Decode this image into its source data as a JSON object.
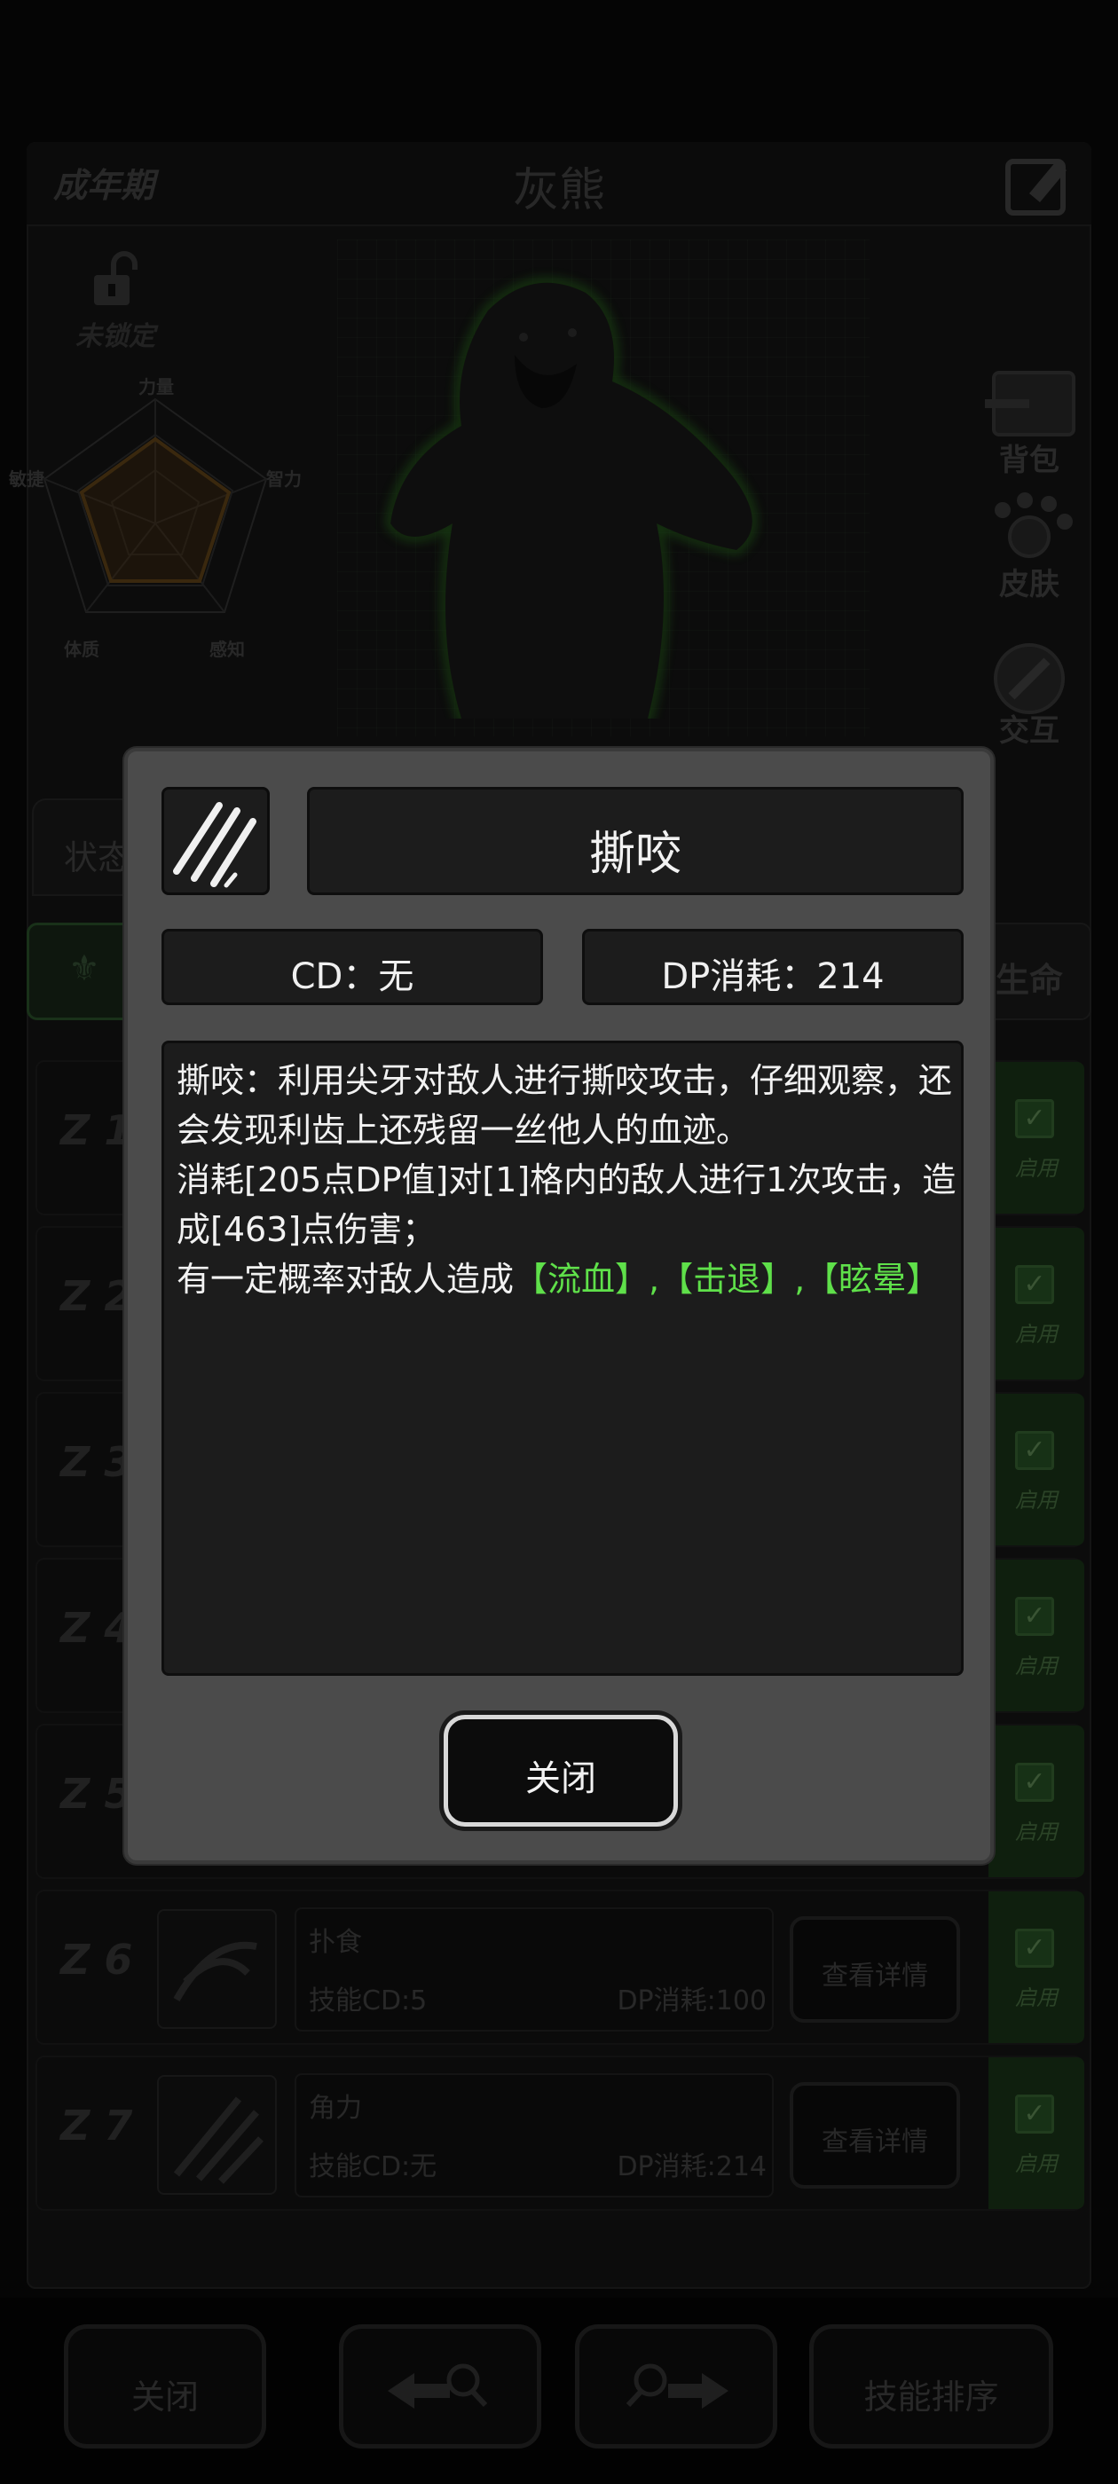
{
  "header": {
    "stage": "成年期",
    "name": "灰熊"
  },
  "lock": {
    "label": "未锁定"
  },
  "radar": {
    "labels": [
      "力量",
      "智力",
      "感知",
      "体质",
      "敏捷"
    ]
  },
  "side_buttons": [
    {
      "label": "背包",
      "icon": "backpack-icon"
    },
    {
      "label": "皮肤",
      "icon": "paw-icon"
    },
    {
      "label": "交互",
      "icon": "hand-icon"
    }
  ],
  "tabs": {
    "status": "状态"
  },
  "filters": {
    "right": "生命"
  },
  "skill_rows": [
    {
      "num": "1",
      "name": "",
      "cd": "",
      "dp": "",
      "detail": "",
      "enable": "启用"
    },
    {
      "num": "2",
      "name": "",
      "cd": "",
      "dp": "",
      "detail": "",
      "enable": "启用"
    },
    {
      "num": "3",
      "name": "",
      "cd": "",
      "dp": "",
      "detail": "",
      "enable": "启用"
    },
    {
      "num": "4",
      "name": "",
      "cd": "",
      "dp": "",
      "detail": "",
      "enable": "启用"
    },
    {
      "num": "5",
      "name": "",
      "cd": "",
      "dp": "",
      "detail": "",
      "enable": "启用"
    },
    {
      "num": "6",
      "name": "扑食",
      "cd": "技能CD:5",
      "dp": "DP消耗:100",
      "detail": "查看详情",
      "enable": "启用"
    },
    {
      "num": "7",
      "name": "角力",
      "cd": "技能CD:无",
      "dp": "DP消耗:214",
      "detail": "查看详情",
      "enable": "启用"
    }
  ],
  "bottom_buttons": {
    "close": "关闭",
    "sort": "技能排序"
  },
  "modal": {
    "title": "撕咬",
    "cd": "CD：无",
    "dp": "DP消耗：214",
    "desc_line1": "撕咬：利用尖牙对敌人进行撕咬攻击，仔细观察，还会发现利齿上还残留一丝他人的血迹。",
    "desc_line2": "消耗[205点DP值]对[1]格内的敌人进行1次攻击，造成[463]点伤害；",
    "desc_line3_prefix": "有一定概率对敌人造成",
    "effects": "【流血】,【击退】,【眩晕】",
    "close": "关闭"
  },
  "colors": {
    "effect_green": "#5fe04a",
    "modal_bg": "#4b4b4b",
    "enable_green": "#1d3a1a"
  }
}
